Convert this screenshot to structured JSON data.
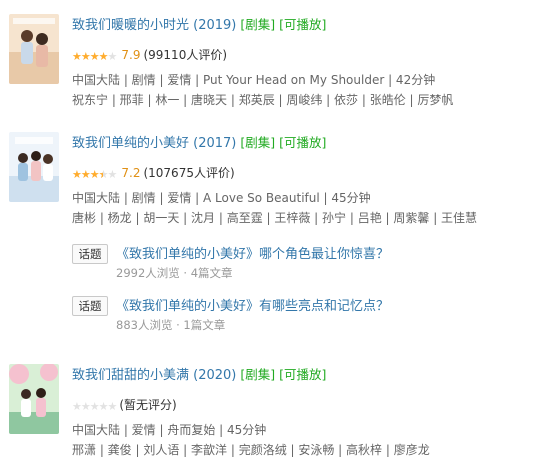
{
  "items": [
    {
      "title": "致我们暖暖的小时光 (2019)",
      "tag_series": "[剧集]",
      "tag_play": "[可播放]",
      "stars": 4,
      "score": "7.9",
      "votes": "(99110人评价)",
      "meta": "中国大陆 | 剧情 | 爱情 | Put Your Head on My Shoulder | 42分钟",
      "cast": "祝东宁 | 邢菲 | 林一 | 唐晓天 | 郑英辰 | 周峻纬 | 依莎 | 张皓伦 | 厉梦帆",
      "poster_colors": [
        "#f3d7b8",
        "#c9d9ea",
        "#e8b9a6"
      ]
    },
    {
      "title": "致我们单纯的小美好 (2017)",
      "tag_series": "[剧集]",
      "tag_play": "[可播放]",
      "stars": 3.5,
      "score": "7.2",
      "votes": "(107675人评价)",
      "meta": "中国大陆 | 剧情 | 爱情 | A Love So Beautiful | 45分钟",
      "cast": "唐彬 | 杨龙 | 胡一天 | 沈月 | 高至霆 | 王梓薇 | 孙宁 | 吕艳 | 周紫馨 | 王佳慧",
      "poster_colors": [
        "#e9f1f8",
        "#9fc3e0",
        "#f2c4c4"
      ]
    },
    {
      "title": "致我们甜甜的小美满 (2020)",
      "tag_series": "[剧集]",
      "tag_play": "[可播放]",
      "stars": 0,
      "score": "",
      "votes": "(暂无评分)",
      "meta": "中国大陆 | 爱情 | 舟而复始 | 45分钟",
      "cast": "邢潇 | 龚俊 | 刘人语 | 李歆洋 | 完颜洛绒 | 安泳畅 | 高秋梓 | 廖彦龙",
      "poster_colors": [
        "#b7dcb5",
        "#f5c1cf",
        "#8fc7a0"
      ]
    }
  ],
  "topics": [
    {
      "badge": "话题",
      "title": "《致我们单纯的小美好》哪个角色最让你惊喜？",
      "sub": "2992人浏览 · 4篇文章"
    },
    {
      "badge": "话题",
      "title": "《致我们单纯的小美好》有哪些亮点和记忆点？",
      "sub": "883人浏览 · 1篇文章"
    }
  ],
  "star_colors": {
    "on": "#ffac2d",
    "off": "#e2e2e2"
  }
}
